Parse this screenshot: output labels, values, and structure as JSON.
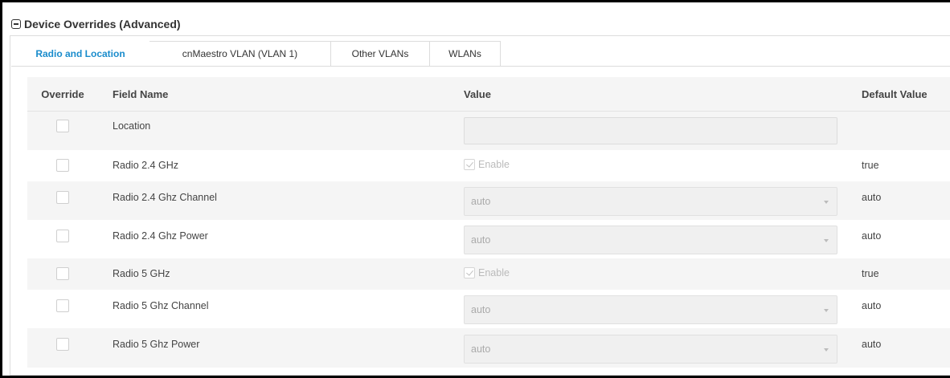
{
  "section": {
    "title": "Device Overrides (Advanced)",
    "collapse_icon": "minus-square-icon"
  },
  "tabs": [
    {
      "label": "Radio and Location",
      "active": true
    },
    {
      "label": "cnMaestro VLAN (VLAN 1)",
      "active": false
    },
    {
      "label": "Other VLANs",
      "active": false
    },
    {
      "label": "WLANs",
      "active": false
    }
  ],
  "table": {
    "headers": {
      "override": "Override",
      "field": "Field Name",
      "value": "Value",
      "default": "Default Value"
    },
    "rows": [
      {
        "field": "Location",
        "value_type": "text",
        "value": "",
        "default": ""
      },
      {
        "field": "Radio 2.4 GHz",
        "value_type": "checkbox",
        "value": "Enable",
        "default": "true"
      },
      {
        "field": "Radio 2.4 Ghz Channel",
        "value_type": "select",
        "value": "auto",
        "default": "auto"
      },
      {
        "field": "Radio 2.4 Ghz Power",
        "value_type": "select",
        "value": "auto",
        "default": "auto"
      },
      {
        "field": "Radio 5 GHz",
        "value_type": "checkbox",
        "value": "Enable",
        "default": "true"
      },
      {
        "field": "Radio 5 Ghz Channel",
        "value_type": "select",
        "value": "auto",
        "default": "auto"
      },
      {
        "field": "Radio 5 Ghz Power",
        "value_type": "select",
        "value": "auto",
        "default": "auto"
      }
    ]
  },
  "colors": {
    "accent": "#1a8ccc",
    "row_alt": "#f5f5f5",
    "border": "#dcdcdc"
  }
}
